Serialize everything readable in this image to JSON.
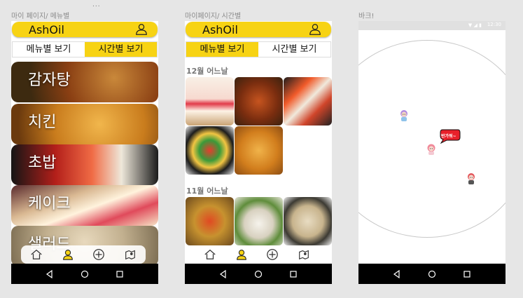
{
  "frames": {
    "menu": {
      "label": "마이 페이지/ 메뉴별"
    },
    "time": {
      "label": "마이페이지/ 시간별"
    },
    "park": {
      "label": "바크!"
    }
  },
  "overflow_dots": "...",
  "profile": {
    "username": "AshOil"
  },
  "toggle": {
    "by_menu": "메뉴별 보기",
    "by_time": "시간별 보기"
  },
  "menu_list": [
    {
      "label": "감자탕"
    },
    {
      "label": "치킨"
    },
    {
      "label": "초밥"
    },
    {
      "label": "케이크"
    },
    {
      "label": "샐러드"
    }
  ],
  "timeline": [
    {
      "title": "12월 어느날"
    },
    {
      "title": "11월 어느날"
    }
  ],
  "status_bar": {
    "time": "12:30"
  },
  "park": {
    "speech": "반가워~"
  },
  "icons": {
    "user": "user-icon",
    "home": "home-icon",
    "profile": "profile-icon",
    "plus": "plus-circle-icon",
    "map": "map-icon",
    "back": "back-triangle-icon",
    "homecircle": "home-circle-icon",
    "recents": "recents-square-icon"
  },
  "colors": {
    "accent": "#f7d314",
    "navbar": "#000000",
    "speech_bubble": "#e8202a"
  }
}
